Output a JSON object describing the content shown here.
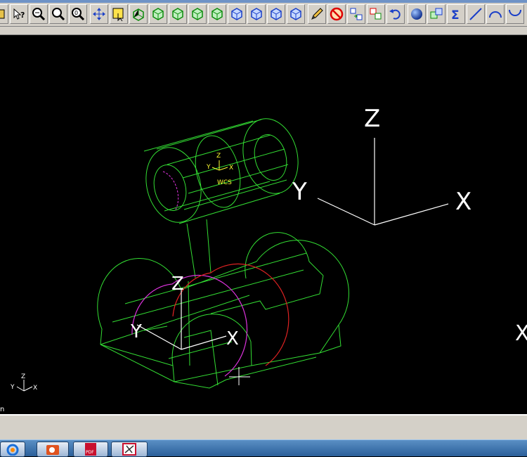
{
  "toolbar": {
    "buttons": [
      "partial-button",
      "help-cursor-button",
      "zoom-window-button",
      "zoom-out-button",
      "zoom-fit-button",
      "pan-button",
      "select-button",
      "rotate-view-button",
      "view-cube-button",
      "view-cube-button",
      "view-cube-button",
      "view-cube-button",
      "view-cube-button",
      "view-cube-button",
      "view-cube-button",
      "view-cube-button",
      "edit-pencil-button",
      "no-entity-button",
      "transform-button",
      "copy-button",
      "undo-button",
      "shade-sphere-button",
      "layer-button",
      "sum-button",
      "line-button",
      "arc-button",
      "curve-button"
    ],
    "sum_glyph": "Σ"
  },
  "viewport": {
    "cursor_x_label": "X",
    "world_axes": {
      "z": "Z",
      "y": "Y",
      "x": "X"
    },
    "part_axes": {
      "z": "Z",
      "y": "Y",
      "x": "X"
    },
    "wcs": {
      "z": "Z",
      "y": "Y",
      "x": "X",
      "label": "WCS"
    },
    "corner_axes": {
      "z": "Z",
      "y": "Y",
      "x": "X"
    },
    "status_char": "n",
    "colors": {
      "wire": "#33dd33",
      "axis": "#ffffff",
      "wcs": "#ffff33",
      "magenta": "#dd33dd",
      "red": "#dd2222"
    }
  },
  "taskbar": {
    "apps": [
      "browser-app",
      "presentation-app",
      "pdf-app",
      "cad-app"
    ],
    "pdf_label": "PDF"
  }
}
